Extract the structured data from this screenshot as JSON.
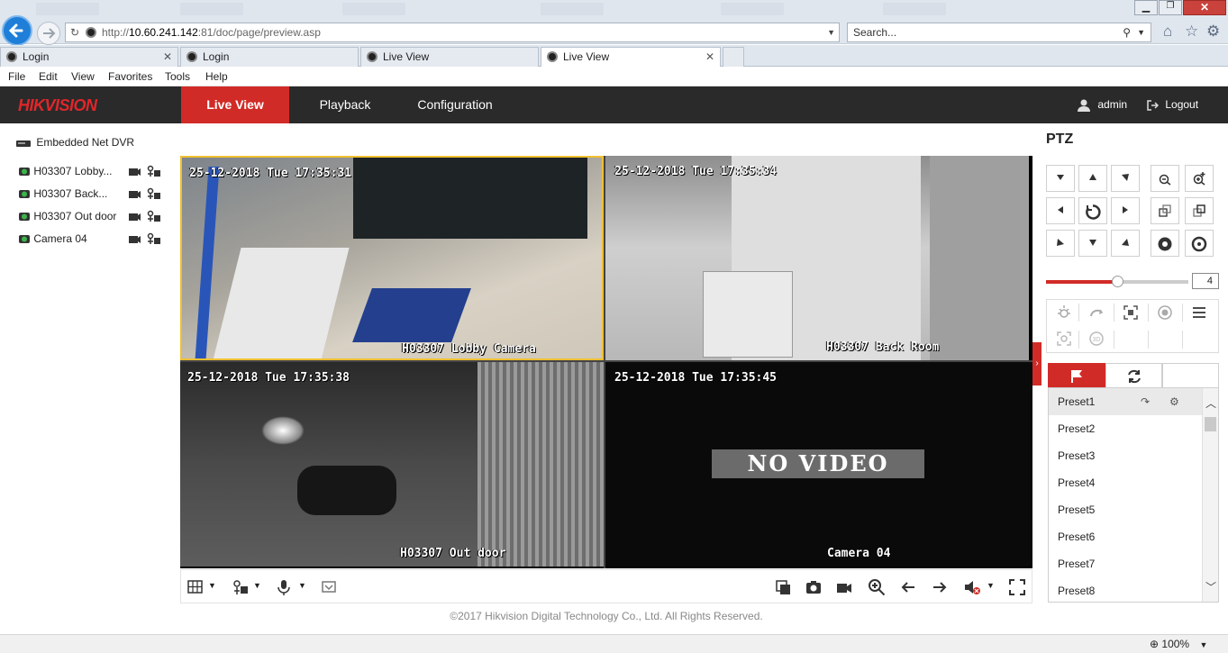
{
  "browser": {
    "address": "http://10.60.241.142:81/doc/page/preview.asp",
    "address_host": "10.60.241.142",
    "address_rest": ":81/doc/page/preview.asp",
    "address_prefix": "http://",
    "search_placeholder": "Search...",
    "tabs": [
      {
        "title": "Login",
        "active": false
      },
      {
        "title": "Login",
        "active": false
      },
      {
        "title": "Live View",
        "active": false
      },
      {
        "title": "Live View",
        "active": true
      }
    ],
    "menu": [
      "File",
      "Edit",
      "View",
      "Favorites",
      "Tools",
      "Help"
    ],
    "zoom": "100%"
  },
  "app": {
    "brand": "HIKVISION",
    "nav": [
      {
        "label": "Live View",
        "active": true
      },
      {
        "label": "Playback",
        "active": false
      },
      {
        "label": "Configuration",
        "active": false
      }
    ],
    "user": "admin",
    "logout": "Logout",
    "accent_color": "#d12b27"
  },
  "device_tree": {
    "root": "Embedded Net DVR",
    "cameras": [
      {
        "label": "H03307 Lobby..."
      },
      {
        "label": "H03307 Back..."
      },
      {
        "label": "H03307 Out door"
      },
      {
        "label": "Camera 04"
      }
    ]
  },
  "video": {
    "channels": [
      {
        "timestamp": "25-12-2018 Tue 17:35:31",
        "name": "H03307 Lobby Camera",
        "selected": true
      },
      {
        "timestamp": "25-12-2018 Tue 17:35:34",
        "name": "H03307 Back Room",
        "selected": false
      },
      {
        "timestamp": "25-12-2018 Tue 17:35:38",
        "name": "H03307 Out door",
        "selected": false
      },
      {
        "timestamp": "25-12-2018 Tue 17:35:45",
        "name": "Camera 04",
        "selected": false,
        "no_video": "NO VIDEO"
      }
    ]
  },
  "footer": "©2017 Hikvision Digital Technology Co., Ltd. All Rights Reserved.",
  "ptz": {
    "title": "PTZ",
    "speed": 4,
    "speed_max": 7,
    "presets": [
      "Preset1",
      "Preset2",
      "Preset3",
      "Preset4",
      "Preset5",
      "Preset6",
      "Preset7",
      "Preset8"
    ]
  }
}
